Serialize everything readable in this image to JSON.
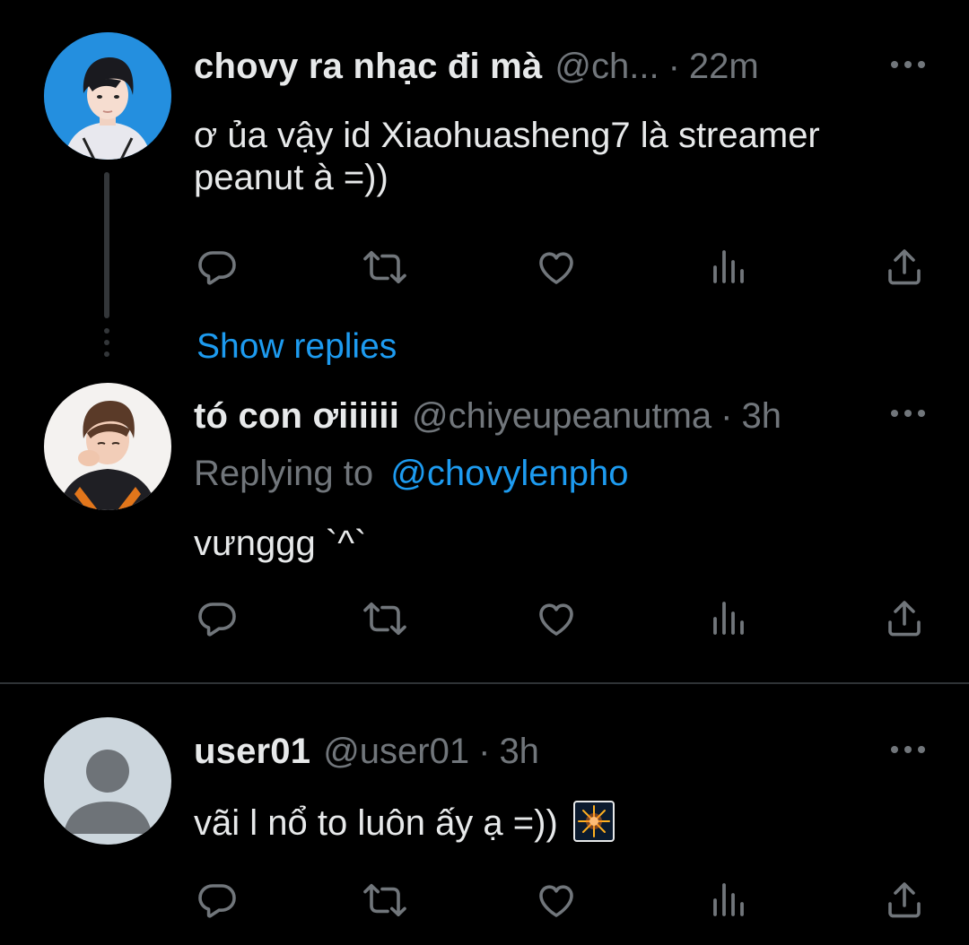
{
  "tweets": [
    {
      "display_name": "chovy ra nhạc đi mà",
      "handle": "@ch...",
      "dot": "·",
      "time": "22m",
      "text_lines": [
        "ơ ủa vậy id Xiaohuasheng7 là streamer",
        "peanut à =))"
      ],
      "avatar": "photo-player-blue-background"
    },
    {
      "display_name": "tó con ơiiiiii",
      "handle": "@chiyeupeanutma",
      "dot": "·",
      "time": "3h",
      "replying_label": "Replying to",
      "replying_to": "@chovylenpho",
      "text": "vưnggg `^`",
      "avatar": "photo-player-crying-white-background"
    },
    {
      "display_name": "user01",
      "handle": "@user01",
      "dot": "·",
      "time": "3h",
      "text": "vãi l nổ to luôn ấy ạ =))",
      "emoji": "fireworks-emoji",
      "avatar": "default-avatar-placeholder"
    }
  ],
  "show_replies": "Show replies",
  "icons": {
    "more": "more-horizontal-icon",
    "reply": "reply-icon",
    "retweet": "retweet-icon",
    "like": "like-icon",
    "views": "views-icon",
    "share": "share-icon"
  },
  "colors": {
    "background": "#000000",
    "primary_text": "#e7e9ea",
    "secondary_text": "#71767b",
    "accent": "#1d9bf0",
    "divider": "#2f3336"
  }
}
